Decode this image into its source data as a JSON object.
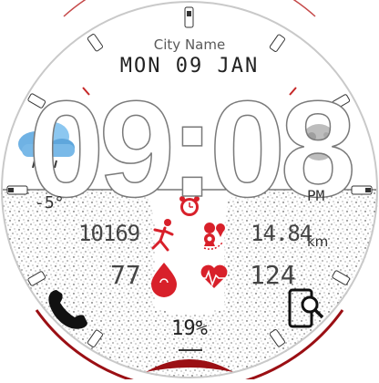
{
  "watch_face": {
    "city": "City Name",
    "date": "MON 09 JAN",
    "time": "09:08",
    "ampm": "PM",
    "temperature": "-5°",
    "steps": "10169",
    "distance": "14.84",
    "distance_unit": "km",
    "heart_rate": "77",
    "calories": "124",
    "battery": "19%",
    "icons": {
      "weather": "cloud-rain-icon",
      "moon": "moon-phase-icon",
      "alarm": "alarm-clock-icon",
      "steps": "running-person-icon",
      "distance": "map-pins-icon",
      "heart": "heart-drop-icon",
      "heartbeat": "heartbeat-icon",
      "phone": "phone-icon",
      "phone_search": "phone-search-icon"
    },
    "colors": {
      "accent": "#d8202a",
      "text": "#222222",
      "bezel": "#9b0f14"
    }
  }
}
